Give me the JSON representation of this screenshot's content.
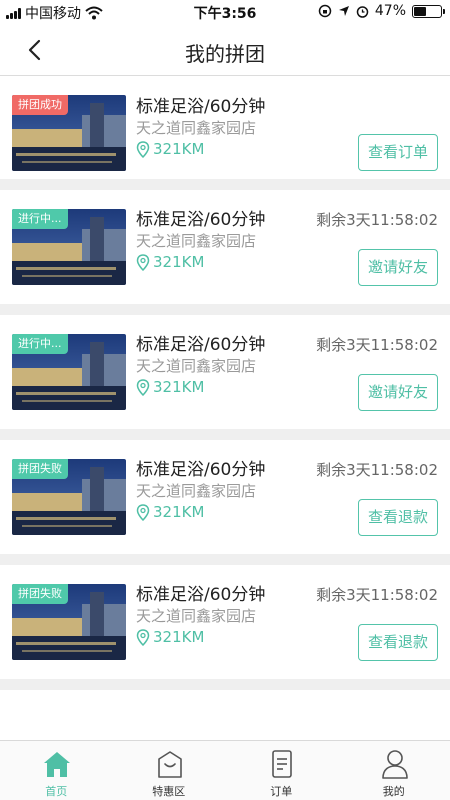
{
  "status_bar": {
    "carrier": "中国移动",
    "time": "下午3:56",
    "battery": "47%",
    "battery_level": 0.47
  },
  "nav": {
    "title": "我的拼团",
    "back_icon": "chevron-left-icon"
  },
  "cards": [
    {
      "badge": "拼团成功",
      "badge_color": "#f06a66",
      "title": "标准足浴/60分钟",
      "store": "天之道同鑫家园店",
      "distance": "321KM",
      "timer": "",
      "action": "查看订单"
    },
    {
      "badge": "进行中...",
      "badge_color": "#4fc9aa",
      "title": "标准足浴/60分钟",
      "store": "天之道同鑫家园店",
      "distance": "321KM",
      "timer": "剩余3天11:58:02",
      "action": "邀请好友"
    },
    {
      "badge": "进行中...",
      "badge_color": "#4fc9aa",
      "title": "标准足浴/60分钟",
      "store": "天之道同鑫家园店",
      "distance": "321KM",
      "timer": "剩余3天11:58:02",
      "action": "邀请好友"
    },
    {
      "badge": "拼团失败",
      "badge_color": "#4fc9aa",
      "title": "标准足浴/60分钟",
      "store": "天之道同鑫家园店",
      "distance": "321KM",
      "timer": "剩余3天11:58:02",
      "action": "查看退款"
    },
    {
      "badge": "拼团失败",
      "badge_color": "#4fc9aa",
      "title": "标准足浴/60分钟",
      "store": "天之道同鑫家园店",
      "distance": "321KM",
      "timer": "剩余3天11:58:02",
      "action": "查看退款"
    }
  ],
  "tabs": [
    {
      "label": "首页",
      "icon": "home-icon",
      "active": true
    },
    {
      "label": "特惠区",
      "icon": "bag-icon",
      "active": false
    },
    {
      "label": "订单",
      "icon": "order-icon",
      "active": false
    },
    {
      "label": "我的",
      "icon": "user-icon",
      "active": false
    }
  ],
  "colors": {
    "accent": "#4fbfa5",
    "success_badge": "#f06a66",
    "divider": "#efefef"
  }
}
